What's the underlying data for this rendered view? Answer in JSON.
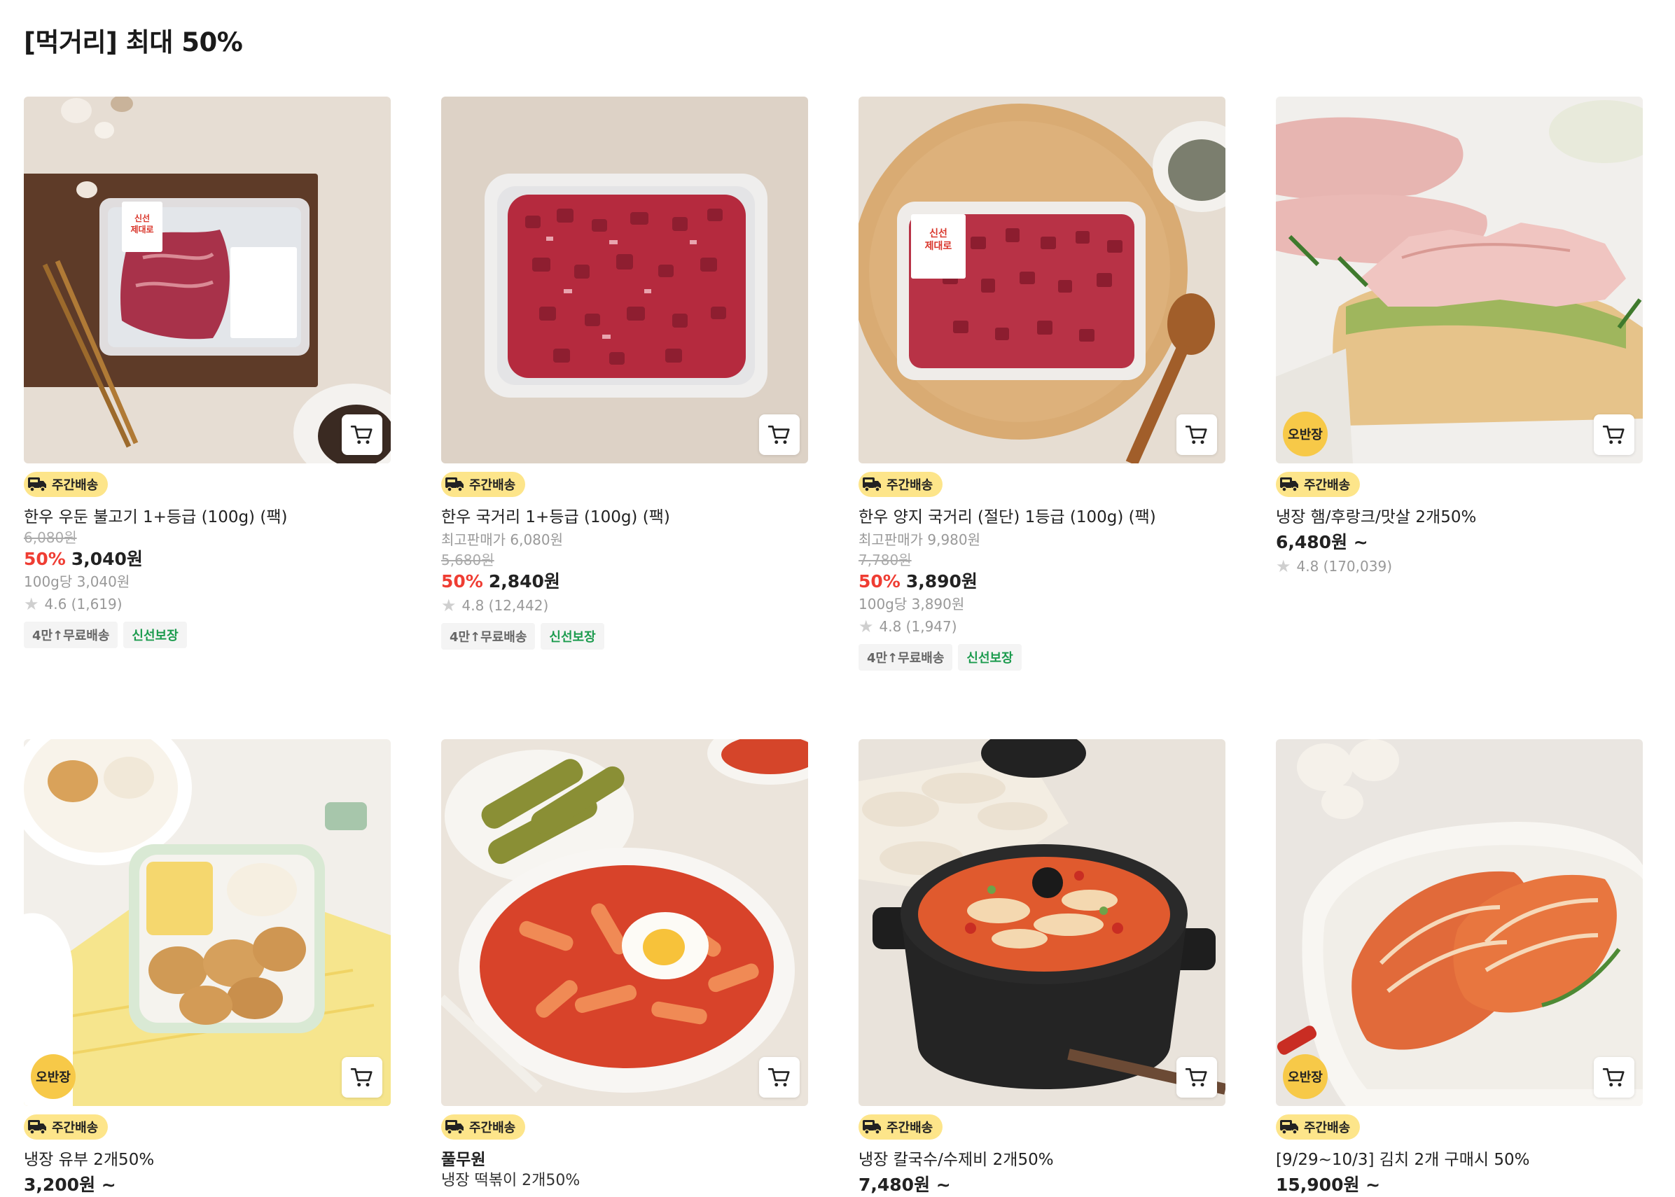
{
  "section": {
    "title": "[먹거리] 최대 50%"
  },
  "labels": {
    "weekly_delivery": "주간배송",
    "obanjang": "오반장"
  },
  "colors": {
    "discount": "#ef3d33",
    "delivery_tag_bg": "#fde58a",
    "free_ship_chip_text": "#666666",
    "fresh_chip_text": "#1c9b4e",
    "badge_bg": "#f7c948"
  },
  "products": [
    {
      "name": "한우 우둔 불고기 1+등급 (100g) (팩)",
      "original_price": "6,080원",
      "discount": "50%",
      "price": "3,040원",
      "unit_price": "100g당 3,040원",
      "rating": "4.6 (1,619)",
      "chips": [
        "4만↑무료배송",
        "신선보장"
      ]
    },
    {
      "name": "한우 국거리 1+등급 (100g) (팩)",
      "ref_price": "최고판매가 6,080원",
      "original_price": "5,680원",
      "discount": "50%",
      "price": "2,840원",
      "rating": "4.8 (12,442)",
      "chips": [
        "4만↑무료배송",
        "신선보장"
      ]
    },
    {
      "name": "한우 양지 국거리 (절단) 1등급 (100g) (팩)",
      "ref_price": "최고판매가 9,980원",
      "original_price": "7,780원",
      "discount": "50%",
      "price": "3,890원",
      "unit_price": "100g당 3,890원",
      "rating": "4.8 (1,947)",
      "chips": [
        "4만↑무료배송",
        "신선보장"
      ]
    },
    {
      "name": "냉장 햄/후랑크/맛살 2개50%",
      "price": "6,480원 ~",
      "rating": "4.8 (170,039)"
    },
    {
      "name": "냉장 유부 2개50%",
      "price": "3,200원 ~"
    },
    {
      "brand": "풀무원",
      "name": "냉장 떡볶이 2개50%"
    },
    {
      "name": "냉장 칼국수/수제비 2개50%",
      "price": "7,480원 ~"
    },
    {
      "name": "[9/29~10/3] 김치 2개 구매시 50%",
      "price": "15,900원 ~"
    }
  ]
}
